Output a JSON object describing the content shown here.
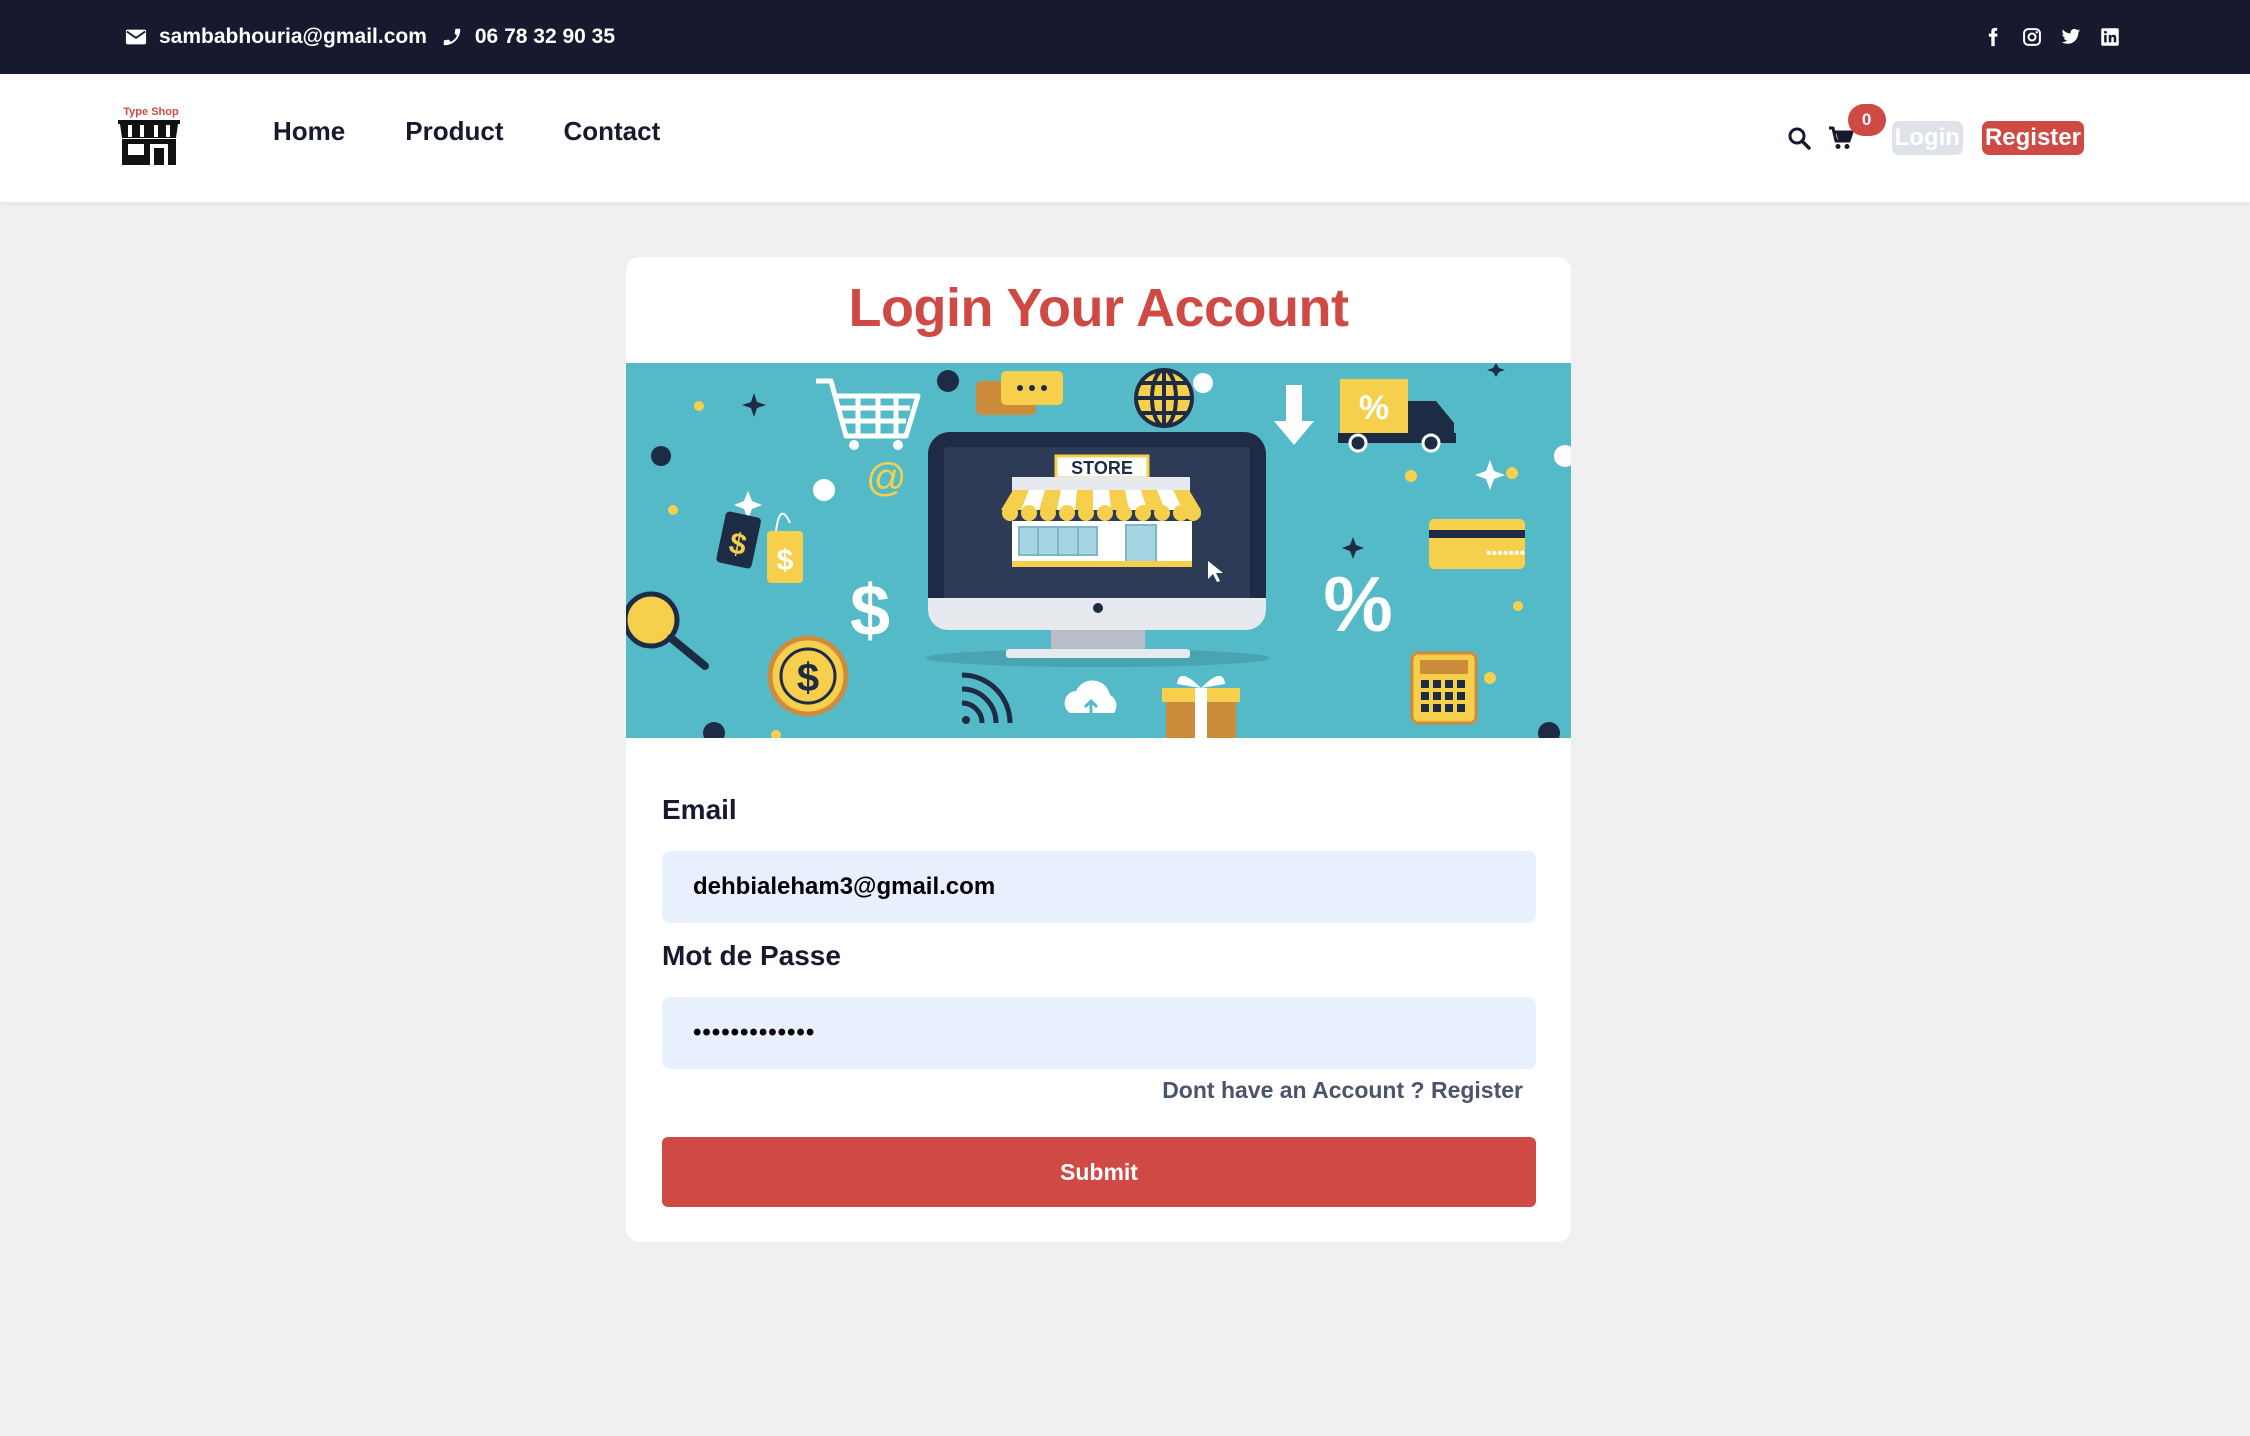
{
  "topbar": {
    "email": "sambabhouria@gmail.com",
    "phone": "06 78 32 90 35",
    "social_icons": [
      "facebook-icon",
      "instagram-icon",
      "twitter-icon",
      "linkedin-icon"
    ]
  },
  "navbar": {
    "logo_text": "Type Shop",
    "links": [
      "Home",
      "Product",
      "Contact"
    ],
    "cart_count": "0",
    "login_label": "Login",
    "register_label": "Register"
  },
  "login": {
    "title": "Login Your Account",
    "banner_store_sign": "STORE",
    "email_label": "Email",
    "email_value": "dehbialeham3@gmail.com",
    "password_label": "Mot de Passe",
    "password_value": "•••••••••••••",
    "account_link": "Dont have an Account ? Register",
    "submit_label": "Submit"
  },
  "colors": {
    "accent": "#d04a45",
    "dark": "#171a2e",
    "banner": "#55bac8",
    "input_bg": "#e8f0fe"
  }
}
